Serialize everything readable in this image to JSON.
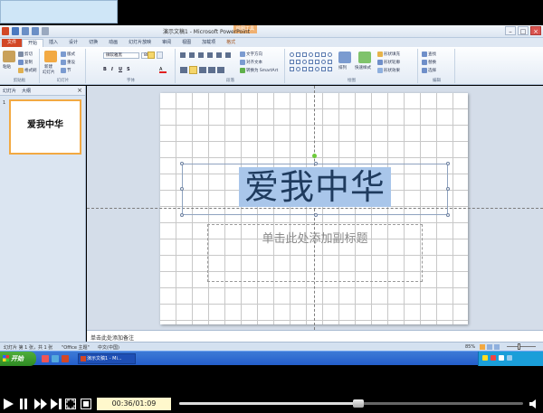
{
  "window": {
    "title": "演示文稿1 - Microsoft PowerPoint",
    "context_tab_group": "绘图工具"
  },
  "tabs": [
    {
      "label": "文件",
      "kind": "file"
    },
    {
      "label": "开始",
      "kind": "active"
    },
    {
      "label": "插入",
      "kind": "normal"
    },
    {
      "label": "设计",
      "kind": "normal"
    },
    {
      "label": "切换",
      "kind": "normal"
    },
    {
      "label": "动画",
      "kind": "normal"
    },
    {
      "label": "幻灯片放映",
      "kind": "normal"
    },
    {
      "label": "审阅",
      "kind": "normal"
    },
    {
      "label": "视图",
      "kind": "normal"
    },
    {
      "label": "加载项",
      "kind": "normal"
    },
    {
      "label": "格式",
      "kind": "format"
    }
  ],
  "ribbon": {
    "clipboard": {
      "paste": "粘贴",
      "cut": "剪切",
      "copy": "复制",
      "format_painter": "格式刷",
      "label": "剪贴板"
    },
    "slides": {
      "new_slide": "新建",
      "new_slide_2": "幻灯片",
      "layout": "版式",
      "reset": "重设",
      "section": "节",
      "label": "幻灯片"
    },
    "font": {
      "font_name": "微软雅黑",
      "font_size": "88",
      "label": "字体"
    },
    "paragraph": {
      "label": "段落",
      "text_direction": "文字方向",
      "align_text": "对齐文本",
      "smartart": "转换为 SmartArt"
    },
    "drawing": {
      "arrange": "排列",
      "quick_styles": "快速样式",
      "shape_fill": "形状填充",
      "shape_outline": "形状轮廓",
      "shape_effects": "形状效果",
      "label": "绘图"
    },
    "editing": {
      "find": "查找",
      "replace": "替换",
      "select": "选择",
      "label": "编辑"
    }
  },
  "left_panel": {
    "tab_slides": "幻灯片",
    "tab_outline": "大纲",
    "slide_number": "1",
    "thumb_title": "爱我中华"
  },
  "slide": {
    "title": "爱我中华",
    "subtitle_placeholder": "单击此处添加副标题"
  },
  "notes_placeholder": "单击此处添加备注",
  "status": {
    "slide_info": "幻灯片 第 1 张，共 1 张",
    "theme": "\"Office 主题\"",
    "language": "中文(中国)",
    "zoom": "85%"
  },
  "taskbar": {
    "start": "开始",
    "app_label": "演示文稿1 - Mi..."
  },
  "player": {
    "time": "00:36/01:09",
    "position_fraction": 0.52
  }
}
